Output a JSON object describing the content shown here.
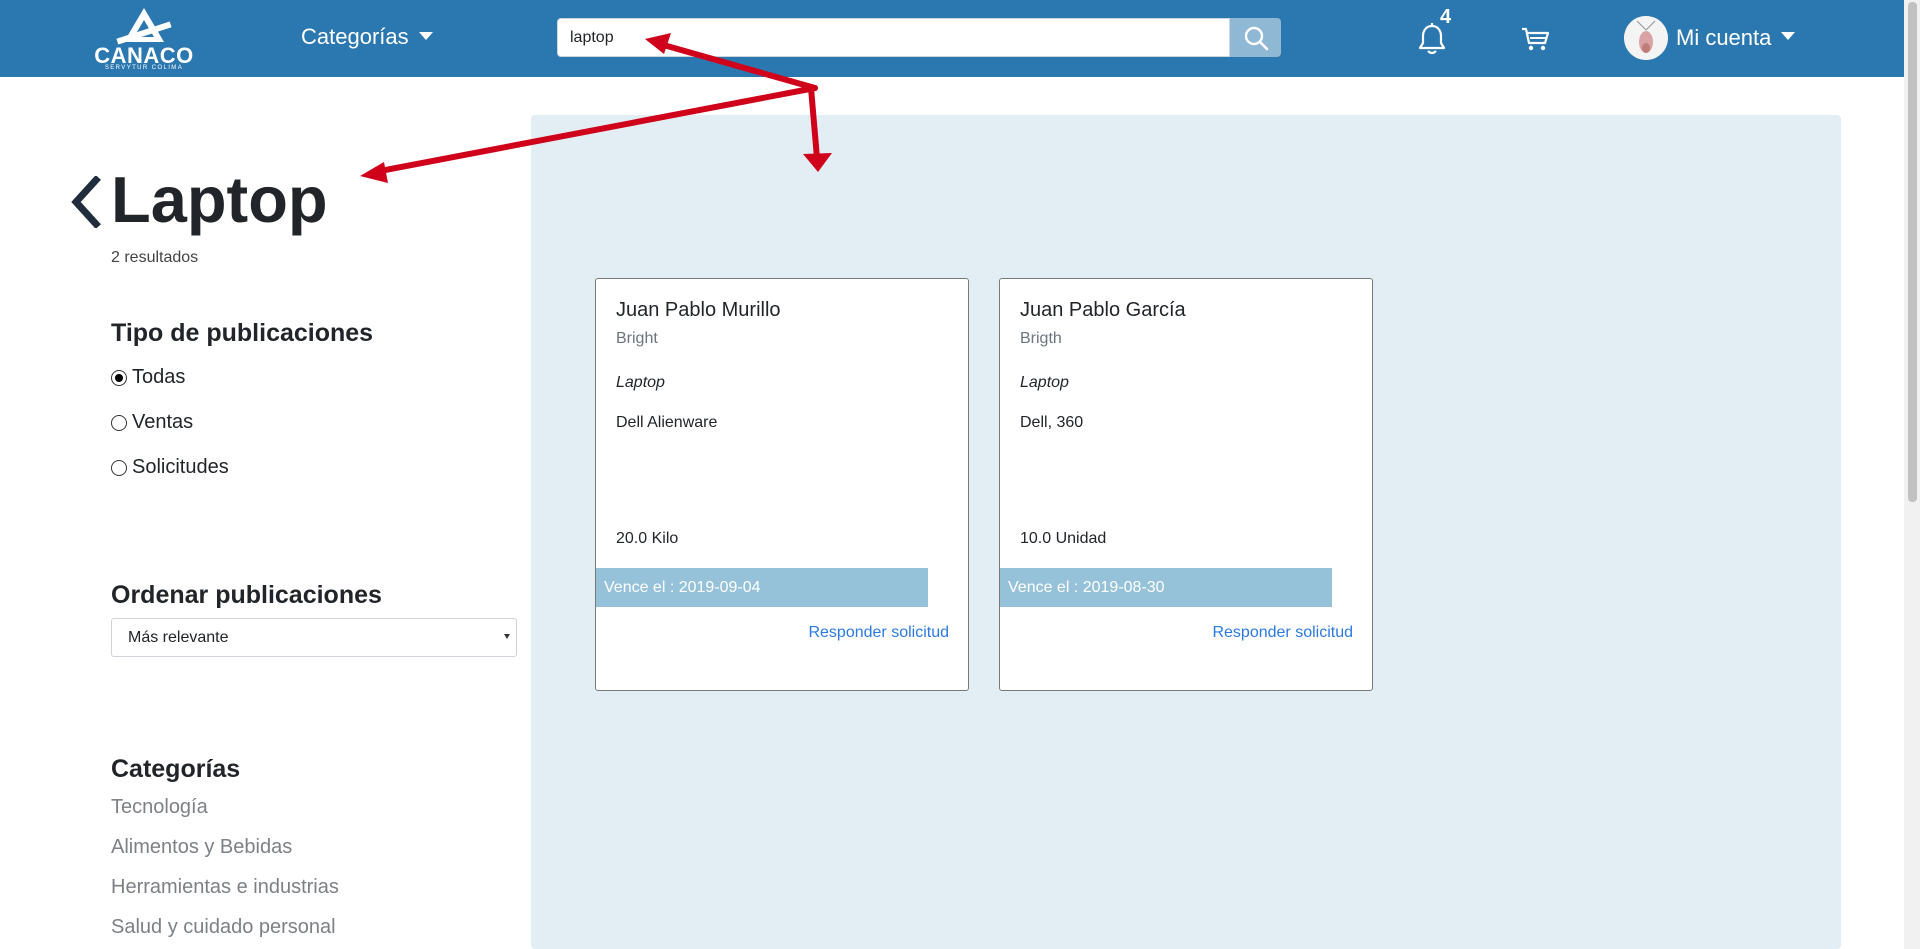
{
  "header": {
    "logo_text": "CANACO",
    "logo_subtext": "SERVYTUR COLIMA",
    "categories_menu_label": "Categorías",
    "search_value": "laptop",
    "notifications_count": "4",
    "account_label": "Mi cuenta",
    "icons": [
      "logo",
      "chevron-down-icon",
      "search-icon",
      "bell-icon",
      "cart-icon",
      "avatar"
    ]
  },
  "sidebar": {
    "title": "Laptop",
    "results_text": "2 resultados",
    "filter_title": "Tipo de publicaciones",
    "filters": [
      {
        "label": "Todas",
        "checked": true
      },
      {
        "label": "Ventas",
        "checked": false
      },
      {
        "label": "Solicitudes",
        "checked": false
      }
    ],
    "sort_title": "Ordenar publicaciones",
    "sort_value": "Más relevante",
    "categories_title": "Categorías",
    "categories": [
      "Tecnología",
      "Alimentos y Bebidas",
      "Herramientas e industrias",
      "Salud y cuidado personal"
    ]
  },
  "results": [
    {
      "author": "Juan Pablo Murillo",
      "company": "Bright",
      "category": "Laptop",
      "description": "Dell Alienware",
      "quantity": "20.0 Kilo",
      "expiry": "Vence el : 2019-09-04",
      "action": "Responder solicitud"
    },
    {
      "author": "Juan Pablo García",
      "company": "Brigth",
      "category": "Laptop",
      "description": "Dell, 360",
      "quantity": "10.0 Unidad",
      "expiry": "Vence el : 2019-08-30",
      "action": "Responder solicitud"
    }
  ],
  "colors": {
    "header_bg": "#2b78b1",
    "search_button": "#8fb8d5",
    "panel_bg": "#e3eef4",
    "expiry_bar": "#96c2d9",
    "link": "#2a7ae2",
    "annotation_arrow": "#d0021b"
  }
}
